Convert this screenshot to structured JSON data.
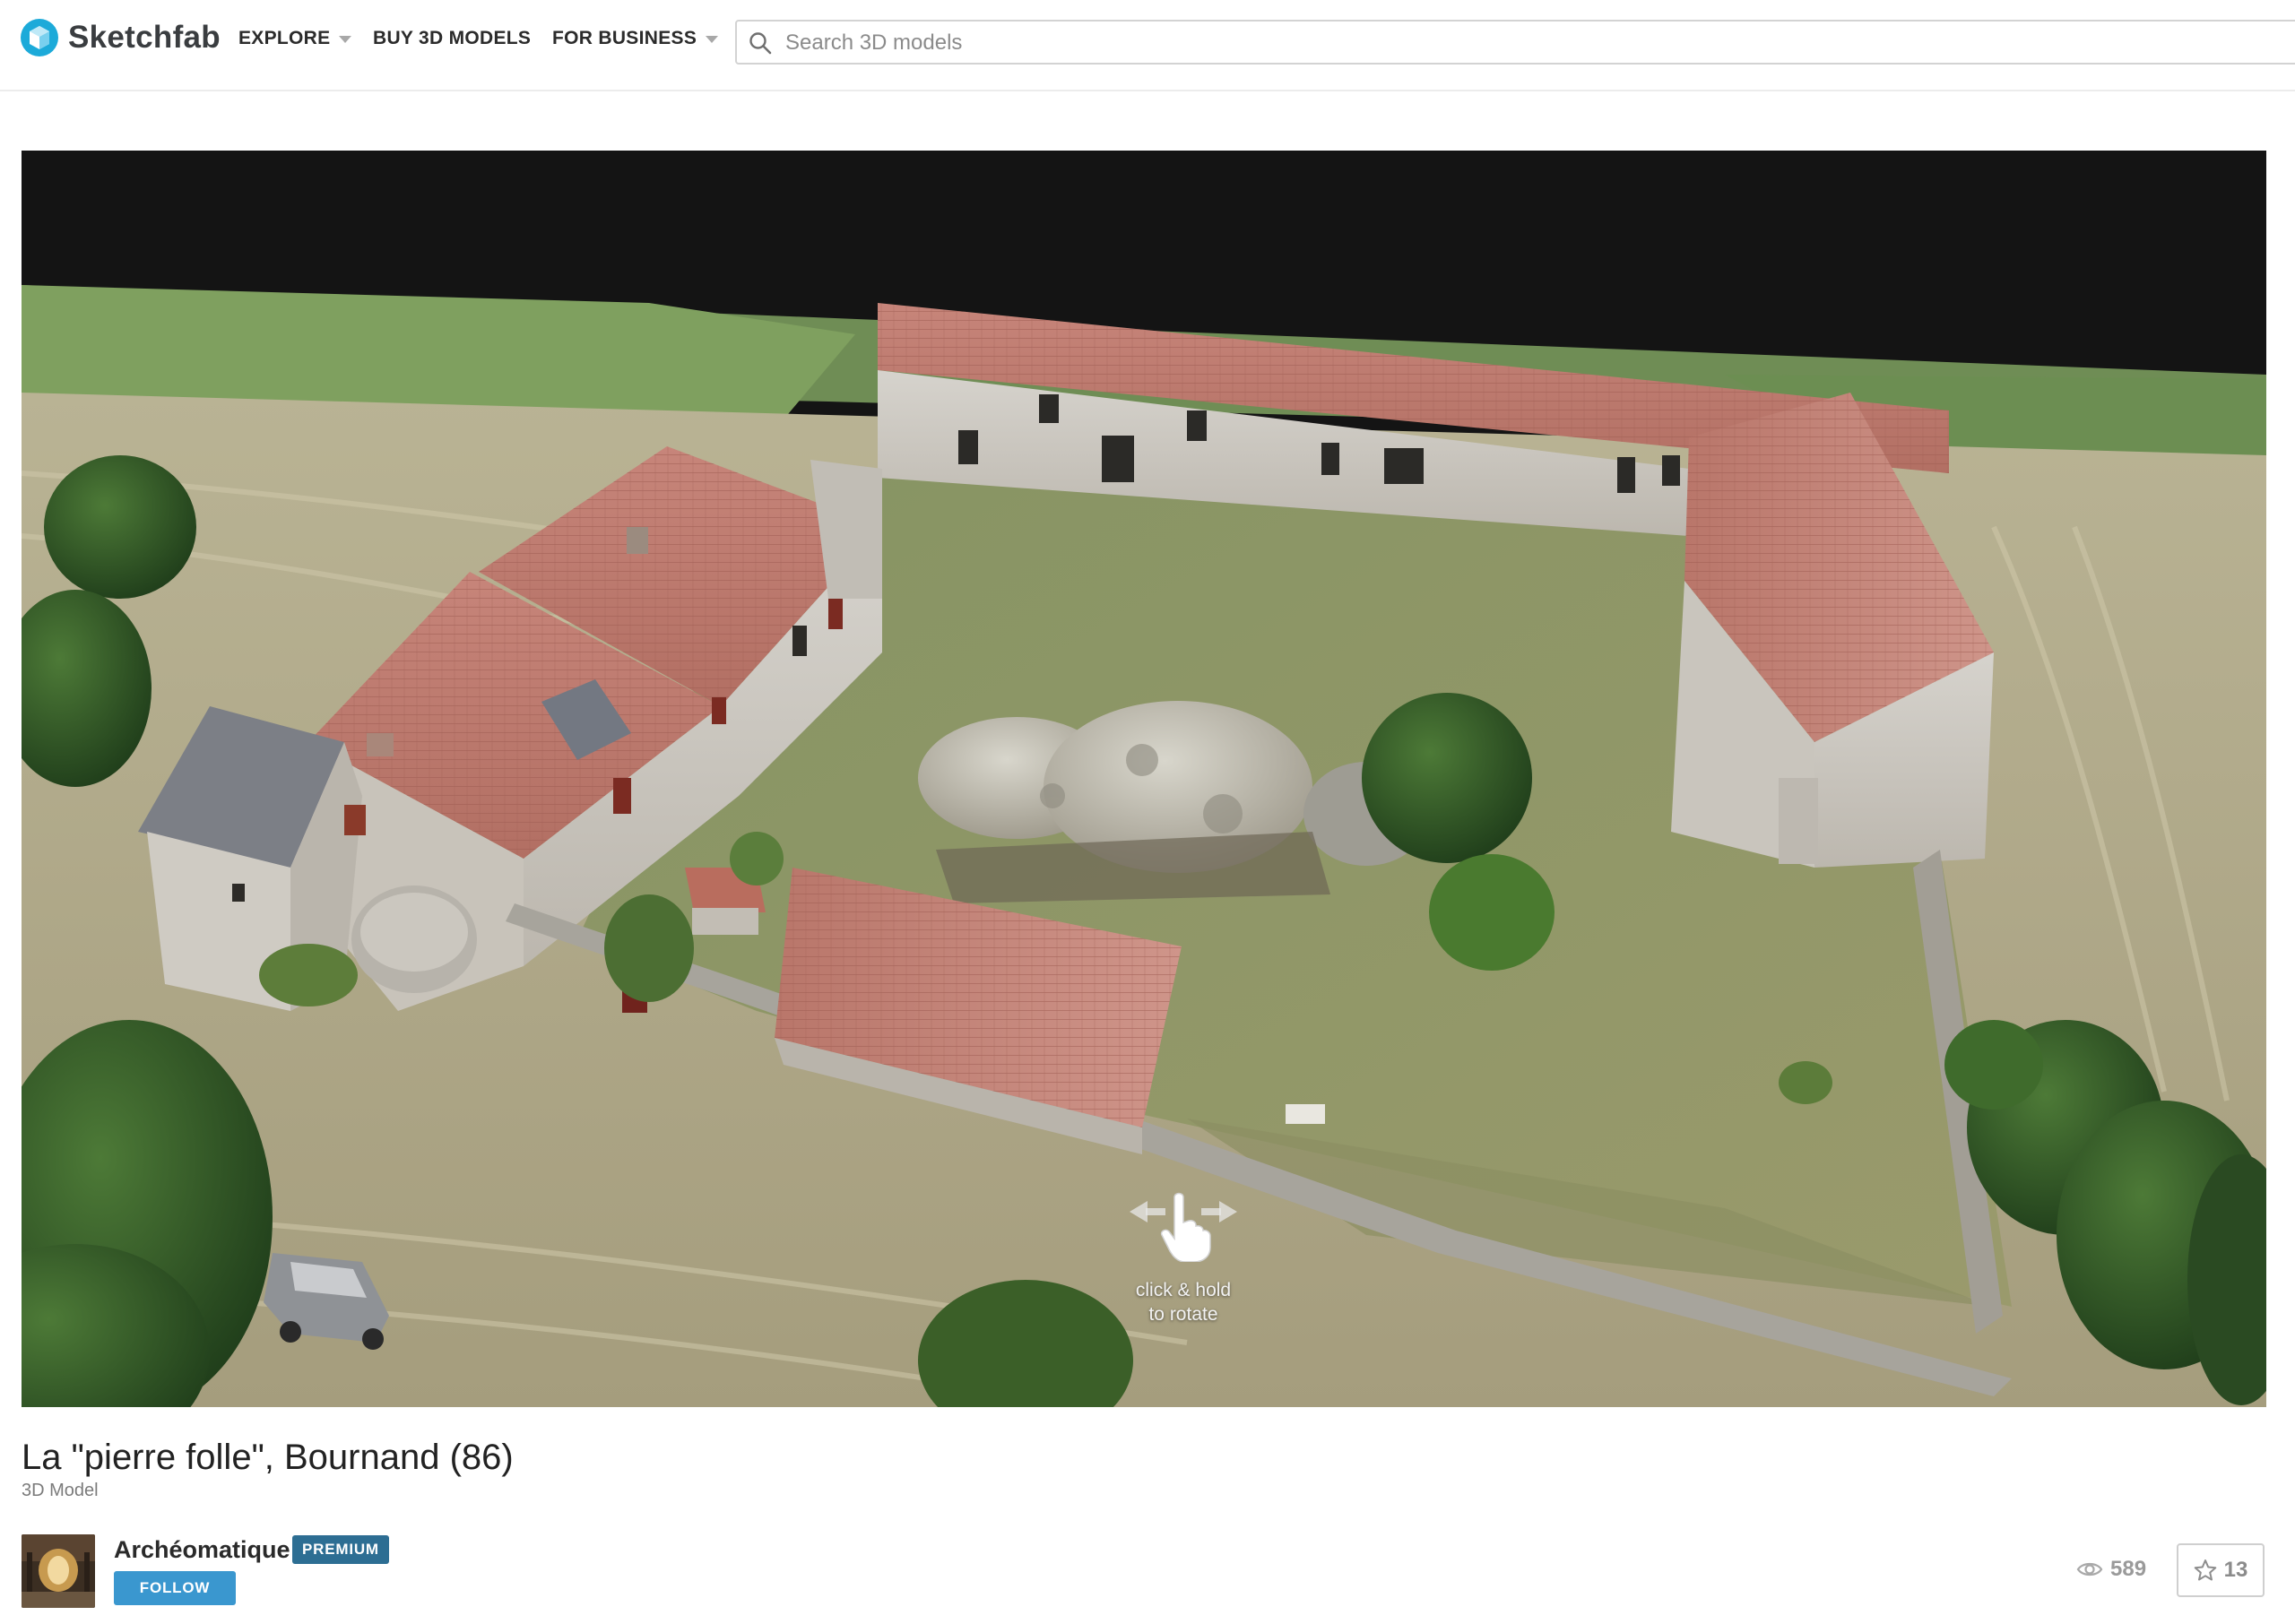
{
  "header": {
    "brand": "Sketchfab",
    "nav": [
      {
        "label": "EXPLORE",
        "has_caret": true
      },
      {
        "label": "BUY 3D MODELS",
        "has_caret": false
      },
      {
        "label": "FOR BUSINESS",
        "has_caret": true
      }
    ],
    "search": {
      "placeholder": "Search 3D models",
      "value": "",
      "icon": "search-icon"
    }
  },
  "viewer": {
    "hint_line1": "click & hold",
    "hint_line2": "to rotate",
    "hint_icon": "hand-drag-icon"
  },
  "model": {
    "title": "La \"pierre folle\", Bournand (86)",
    "type": "3D Model"
  },
  "author": {
    "name": "Archéomatique",
    "badge": "PREMIUM",
    "follow_label": "FOLLOW"
  },
  "stats": {
    "views": "589",
    "likes": "13",
    "views_icon": "eye-icon",
    "likes_icon": "star-icon"
  },
  "colors": {
    "brand_blue": "#1caad9",
    "premium_badge": "#2d6e93",
    "follow_button": "#3a97cf",
    "text_dark": "#222222"
  }
}
